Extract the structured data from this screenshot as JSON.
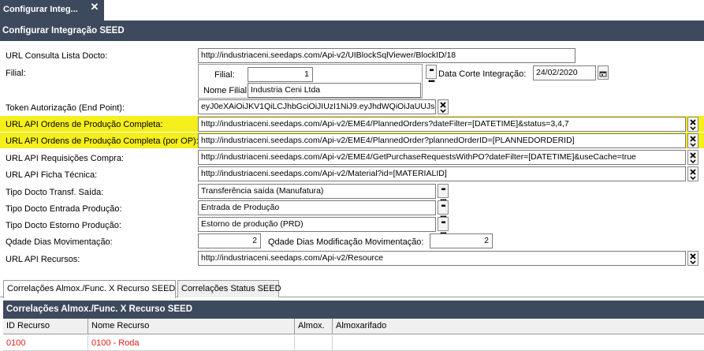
{
  "tab": {
    "title": "Configurar Integ...",
    "close_label": "✕"
  },
  "header": {
    "title": "Configurar Integração SEED"
  },
  "fields": {
    "url_lista_docto": {
      "label": "URL Consulta Lista Docto:",
      "value": "http://industriaceni.seedaps.com/Api-v2/UIBlockSqlViewer/BlockID/18"
    },
    "filial": {
      "label": "Filial:",
      "filial_label": "Filial:",
      "filial_value": "1",
      "nome_label": "Nome Filial:",
      "nome_value": "Industria Ceni Ltda"
    },
    "data_corte": {
      "label": "Data Corte Integração:",
      "value": "24/02/2020"
    },
    "token": {
      "label": "Token Autorização (End Point):",
      "value": "eyJ0eXAiOiJKV1QiLCJhbGciOiJIUzI1NiJ9.eyJhdWQiOiJaUUJs"
    },
    "url_ordens": {
      "label": "URL API Ordens de Produção Completa:",
      "value": "http://industriaceni.seedaps.com/Api-v2/EME4/PlannedOrders?dateFilter=[DATETIME]&status=3,4,7"
    },
    "url_ordens_op": {
      "label": "URL API Ordens de Produção Completa (por OP):",
      "value": "http://industriaceni.seedaps.com/Api-v2/EME4/PlannedOrder?plannedOrderID=[PLANNEDORDERID]"
    },
    "url_requisicoes": {
      "label": "URL API Requisições Compra:",
      "value": "http://industriaceni.seedaps.com/Api-v2/EME4/GetPurchaseRequestsWithPO?dateFilter=[DATETIME]&useCache=true"
    },
    "url_ficha": {
      "label": "URL API Ficha Técnica:",
      "value": "http://industriaceni.seedaps.com/Api-v2/Material?id=[MATERIALID]"
    },
    "tipo_saida": {
      "label": "Tipo Docto Transf. Saída:",
      "value": "Transferência saída (Manufatura)"
    },
    "tipo_entrada": {
      "label": "Tipo Docto Entrada Produção:",
      "value": "Entrada de Produção"
    },
    "tipo_estorno": {
      "label": "Tipo Docto Estorno Produção:",
      "value": "Estorno de produção (PRD)"
    },
    "qdade_mov": {
      "label": "Qdade Dias Movimentação:",
      "value": "2"
    },
    "qdade_mod": {
      "label": "Qdade Dias Modificação Movimentação:",
      "value": "2"
    },
    "url_recursos": {
      "label": "URL API Recursos:",
      "value": "http://industriaceni.seedaps.com/Api-v2/Resource"
    }
  },
  "subtabs": [
    {
      "label": "Correlações Almox./Func. X Recurso SEED"
    },
    {
      "label": "Correlações Status SEED"
    }
  ],
  "grid": {
    "title": "Correlações Almox./Func. X Recurso SEED",
    "columns": [
      "ID Recurso",
      "Nome Recurso",
      "Almox.",
      "Almoxarifado"
    ],
    "rows": [
      {
        "id": "0100",
        "nome": "0100 - Roda",
        "almox": "",
        "almoxarifado": ""
      }
    ]
  },
  "colors": {
    "header_bg": "#3d4a5d",
    "highlight": "#f5ef1c",
    "row_text": "#e0201c"
  }
}
